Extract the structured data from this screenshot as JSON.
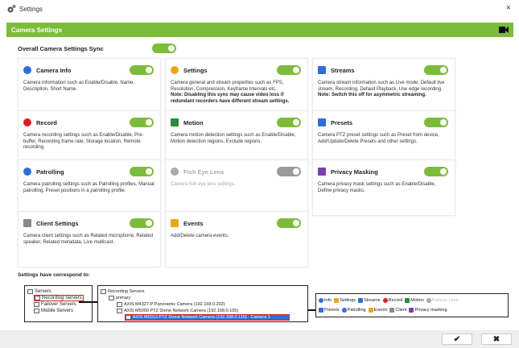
{
  "window": {
    "title": "Settings",
    "close_glyph": "×"
  },
  "header": {
    "title": "Camera Settings"
  },
  "overall": {
    "label": "Overall Camera Settings Sync",
    "enabled": true
  },
  "colors": {
    "accent": "#7dbb3a",
    "toggle_off": "#9a9a9a",
    "highlight": "#e02020",
    "selection": "#2f6fd6"
  },
  "cards": [
    {
      "title": "Camera Info",
      "icon": "info-icon",
      "enabled": true,
      "desc": "Camera information such as Enable/Disable, Name, Description, Short Name.",
      "note": ""
    },
    {
      "title": "Settings",
      "icon": "settings-icon",
      "enabled": true,
      "desc": "Camera general and stream properties such as FPS, Resolution, Compression, Keyframe Intervals etc.",
      "note": "Note: Disabling this sync may cause video loss if redundant recorders have different stream settings."
    },
    {
      "title": "Streams",
      "icon": "streams-icon",
      "enabled": true,
      "desc": "Camera stream information such as Live mode, Default live stream, Recording, Default Playback, Use edge recording.",
      "note": "Note: Switch this off for asymmetric streaming."
    },
    {
      "title": "Record",
      "icon": "record-icon",
      "enabled": true,
      "desc": "Camera recording settings such as Enable/Disable, Pre-buffer, Recording frame rate, Storage location, Remote recording.",
      "note": ""
    },
    {
      "title": "Motion",
      "icon": "motion-icon",
      "enabled": true,
      "desc": "Camera motion detection settings such as Enable/Disable, Motion detection regions, Exclude regions.",
      "note": ""
    },
    {
      "title": "Presets",
      "icon": "presets-icon",
      "enabled": true,
      "desc": "Camera PTZ preset settings such as Preset from device, Add/Update/Delete Presets and other settings.",
      "note": ""
    },
    {
      "title": "Patrolling",
      "icon": "patrolling-icon",
      "enabled": true,
      "desc": "Camera patrolling settings such as Patrolling profiles, Manual patrolling, Preset positions in a patrolling profile.",
      "note": ""
    },
    {
      "title": "Fish Eye Lens",
      "icon": "fisheye-icon",
      "enabled": false,
      "desc": "Camera fish eye lens settings.",
      "note": ""
    },
    {
      "title": "Privacy Masking",
      "icon": "privacy-icon",
      "enabled": true,
      "desc": "Camera privacy mask settings such as Enable/Disable, Define privacy masks.",
      "note": ""
    },
    {
      "title": "Client Settings",
      "icon": "client-icon",
      "enabled": true,
      "desc": "Camera client settings such as Related microphone, Related speaker, Related metadata, Live multicast.",
      "note": ""
    },
    {
      "title": "Events",
      "icon": "events-icon",
      "enabled": true,
      "desc": "Add/Delete camera events.",
      "note": ""
    }
  ],
  "correspond": {
    "label": "Settings have correspond to:"
  },
  "tree_servers": [
    "Servers",
    "Recording Servers",
    "Failover Servers",
    "Mobile Servers"
  ],
  "tree_recording": [
    "Recording Servers",
    "primary",
    "AXIS M4327-P Panoramic Camera (192.168.0.202)",
    "AXIS M5000 PTZ Dome Network Camera (192.168.0.105)",
    "AXIS M5013 PTZ Dome Network Camera (192.168.0.115) - Camera 1"
  ],
  "legend": {
    "row1": [
      "Info",
      "Settings",
      "Streams",
      "Record",
      "Motion",
      "Fisheye Lens"
    ],
    "row2": [
      "Presets",
      "Patrolling",
      "Events",
      "Client",
      "Privacy masking"
    ]
  },
  "buttons": {
    "ok_glyph": "✔",
    "cancel_glyph": "✖"
  }
}
